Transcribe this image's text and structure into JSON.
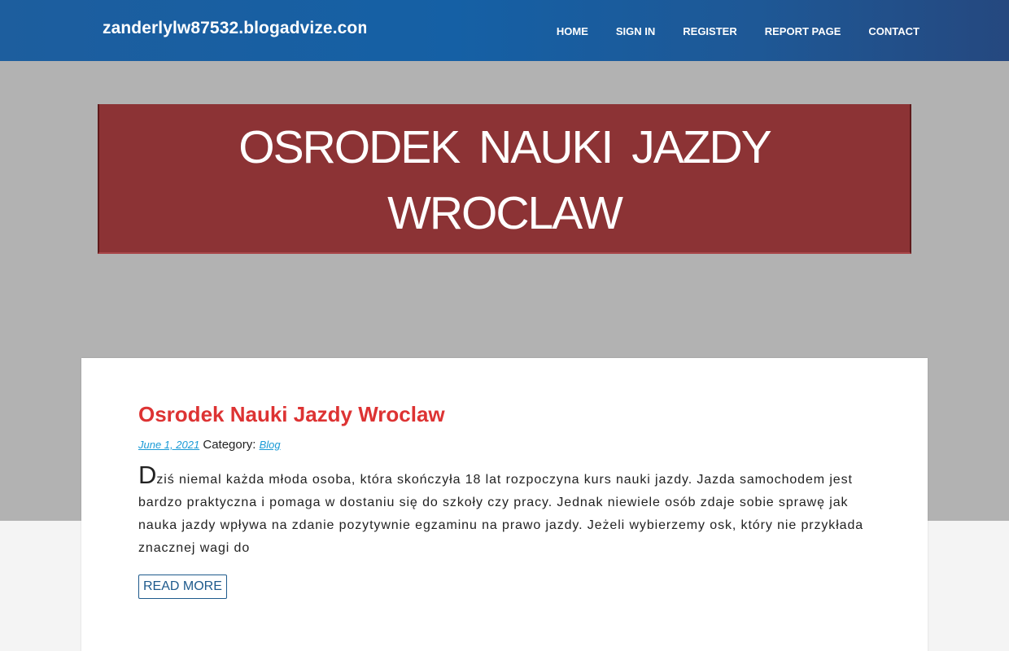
{
  "header": {
    "site_title": "zanderlylw87532.blogadvize.com",
    "nav": [
      {
        "label": "HOME"
      },
      {
        "label": "SIGN IN"
      },
      {
        "label": "REGISTER"
      },
      {
        "label": "REPORT PAGE"
      },
      {
        "label": "CONTACT"
      }
    ]
  },
  "hero": {
    "title": "OSRODEK NAUKI JAZDY WROCLAW"
  },
  "post": {
    "title": "Osrodek Nauki Jazdy Wroclaw",
    "date": "June 1, 2021",
    "category_label": "Category:",
    "category": "Blog",
    "excerpt_first_letter": "D",
    "excerpt_rest": "ziś niemal każda młoda osoba, która skończyła 18 lat rozpoczyna kurs nauki jazdy. Jazda samochodem jest bardzo praktyczna i pomaga w dostaniu się do szkoły czy pracy. Jednak niewiele osób zdaje sobie sprawę jak nauka jazdy wpływa na zdanie pozytywnie egzaminu na prawo jazdy. Jeżeli wybierzemy osk, który nie przykłada znacznej wagi do",
    "read_more_label": "READ MORE"
  },
  "colors": {
    "header_blue": "#1560a5",
    "hero_red": "#8c3335",
    "post_title_red": "#dd3333",
    "link_blue": "#1a9ad6",
    "background_gray": "#b2b2b2"
  }
}
